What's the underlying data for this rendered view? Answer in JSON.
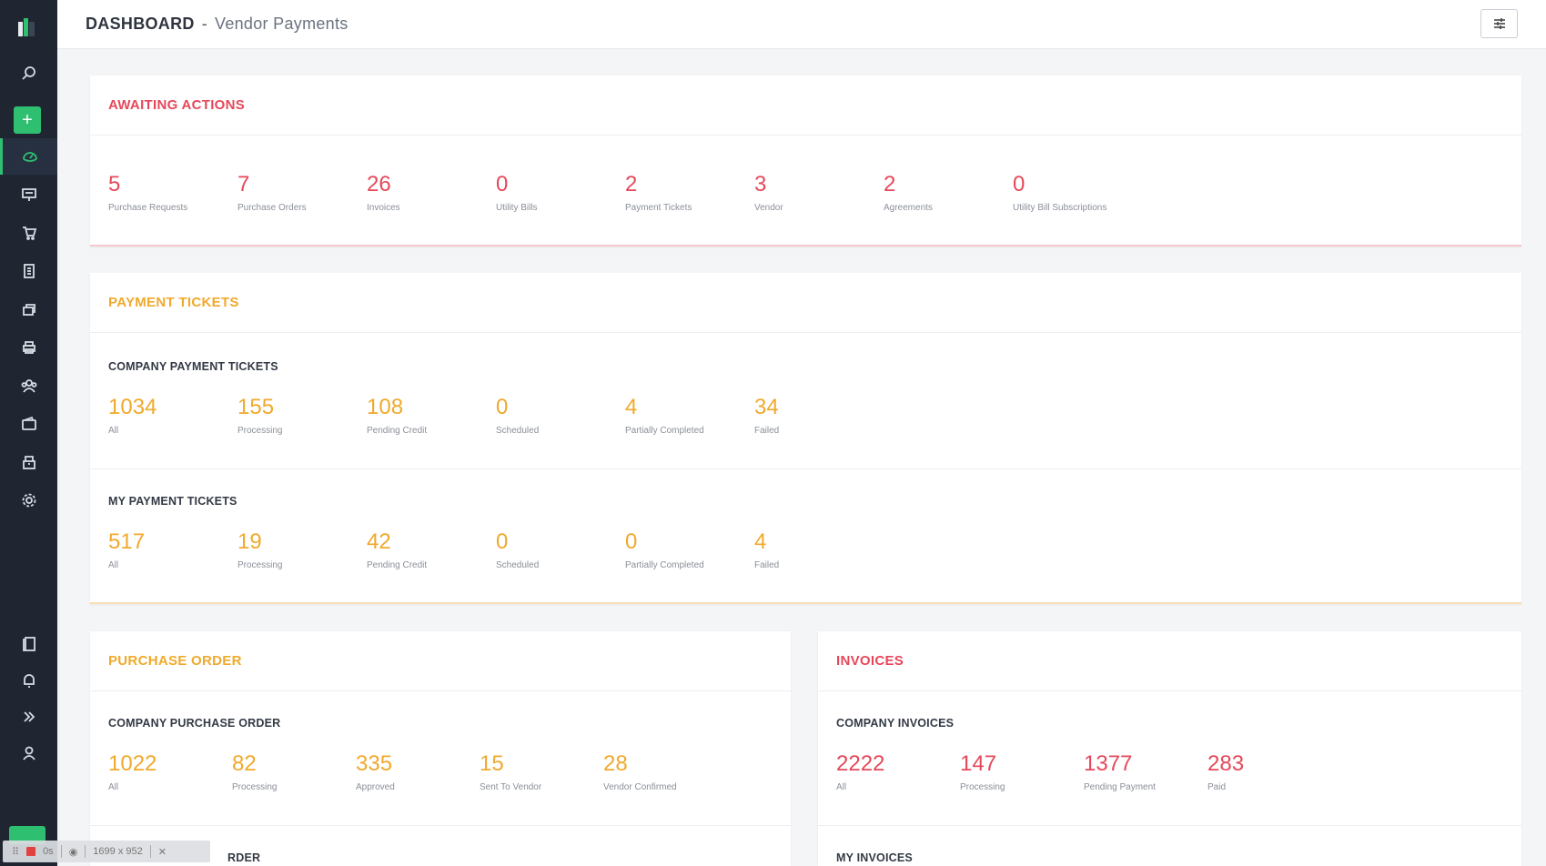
{
  "header": {
    "title": "DASHBOARD",
    "separator": "-",
    "subtitle": "Vendor Payments"
  },
  "sidebar": {
    "items": [
      {
        "icon": "search-icon"
      },
      {
        "icon": "add-icon",
        "label": "+"
      },
      {
        "icon": "dashboard-icon",
        "active": true
      },
      {
        "icon": "requests-icon"
      },
      {
        "icon": "cart-icon"
      },
      {
        "icon": "invoice-icon"
      },
      {
        "icon": "bills-icon"
      },
      {
        "icon": "print-icon"
      },
      {
        "icon": "vendors-icon"
      },
      {
        "icon": "wallet-icon"
      },
      {
        "icon": "building-icon"
      },
      {
        "icon": "settings-icon"
      },
      {
        "icon": "docs-icon"
      },
      {
        "icon": "bell-icon"
      },
      {
        "icon": "expand-icon"
      },
      {
        "icon": "user-icon"
      }
    ]
  },
  "awaiting": {
    "title": "AWAITING ACTIONS",
    "stats": [
      {
        "value": "5",
        "label": "Purchase Requests"
      },
      {
        "value": "7",
        "label": "Purchase Orders"
      },
      {
        "value": "26",
        "label": "Invoices"
      },
      {
        "value": "0",
        "label": "Utility Bills"
      },
      {
        "value": "2",
        "label": "Payment Tickets"
      },
      {
        "value": "3",
        "label": "Vendor"
      },
      {
        "value": "2",
        "label": "Agreements"
      },
      {
        "value": "0",
        "label": "Utility Bill Subscriptions"
      }
    ]
  },
  "payment_tickets": {
    "title": "PAYMENT TICKETS",
    "company": {
      "title": "COMPANY PAYMENT TICKETS",
      "stats": [
        {
          "value": "1034",
          "label": "All"
        },
        {
          "value": "155",
          "label": "Processing"
        },
        {
          "value": "108",
          "label": "Pending Credit"
        },
        {
          "value": "0",
          "label": "Scheduled"
        },
        {
          "value": "4",
          "label": "Partially Completed"
        },
        {
          "value": "34",
          "label": "Failed"
        }
      ]
    },
    "mine": {
      "title": "MY PAYMENT TICKETS",
      "stats": [
        {
          "value": "517",
          "label": "All"
        },
        {
          "value": "19",
          "label": "Processing"
        },
        {
          "value": "42",
          "label": "Pending Credit"
        },
        {
          "value": "0",
          "label": "Scheduled"
        },
        {
          "value": "0",
          "label": "Partially Completed"
        },
        {
          "value": "4",
          "label": "Failed"
        }
      ]
    }
  },
  "purchase_order": {
    "title": "PURCHASE ORDER",
    "company": {
      "title": "COMPANY PURCHASE ORDER",
      "stats": [
        {
          "value": "1022",
          "label": "All"
        },
        {
          "value": "82",
          "label": "Processing"
        },
        {
          "value": "335",
          "label": "Approved"
        },
        {
          "value": "15",
          "label": "Sent To Vendor"
        },
        {
          "value": "28",
          "label": "Vendor Confirmed"
        }
      ]
    },
    "mine_title_visible": "RDER"
  },
  "invoices": {
    "title": "INVOICES",
    "company": {
      "title": "COMPANY INVOICES",
      "stats": [
        {
          "value": "2222",
          "label": "All"
        },
        {
          "value": "147",
          "label": "Processing"
        },
        {
          "value": "1377",
          "label": "Pending Payment"
        },
        {
          "value": "283",
          "label": "Paid"
        }
      ]
    },
    "mine_title": "MY INVOICES"
  },
  "recorder": {
    "time": "0s",
    "size": "1699 x 952",
    "close": "✕"
  },
  "colors": {
    "sidebar_bg": "#1f2632",
    "accent_green": "#2fbf71",
    "red": "#e5485a",
    "orange": "#f0a92c"
  }
}
